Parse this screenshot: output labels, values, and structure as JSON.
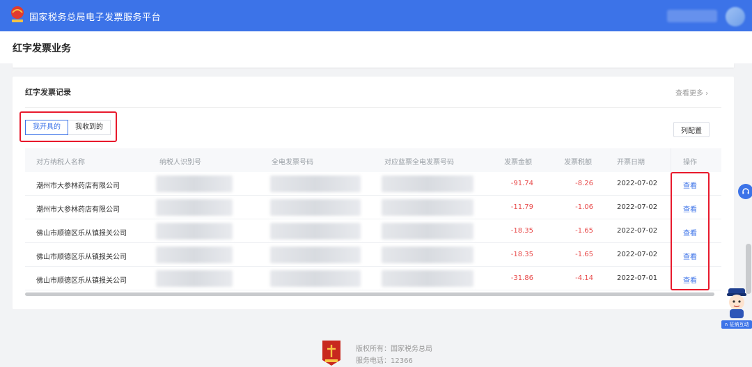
{
  "header": {
    "site_title": "国家税务总局电子发票服务平台"
  },
  "page": {
    "title": "红字发票业务"
  },
  "records": {
    "title": "红字发票记录",
    "more_label": "查看更多 ›",
    "tabs": [
      {
        "label": "我开具的",
        "active": true
      },
      {
        "label": "我收到的",
        "active": false
      }
    ],
    "column_config_label": "列配置",
    "columns": [
      "对方纳税人名称",
      "纳税人识别号",
      "全电发票号码",
      "对应蓝票全电发票号码",
      "发票金额",
      "发票税额",
      "开票日期",
      "操作"
    ],
    "rows": [
      {
        "name": "潮州市大参林药店有限公司",
        "amount": "-91.74",
        "tax": "-8.26",
        "date": "2022-07-02",
        "action": "查看"
      },
      {
        "name": "潮州市大参林药店有限公司",
        "amount": "-11.79",
        "tax": "-1.06",
        "date": "2022-07-02",
        "action": "查看"
      },
      {
        "name": "佛山市顺德区乐从镇报关公司",
        "amount": "-18.35",
        "tax": "-1.65",
        "date": "2022-07-02",
        "action": "查看"
      },
      {
        "name": "佛山市顺德区乐从镇报关公司",
        "amount": "-18.35",
        "tax": "-1.65",
        "date": "2022-07-02",
        "action": "查看"
      },
      {
        "name": "佛山市顺德区乐从镇报关公司",
        "amount": "-31.86",
        "tax": "-4.14",
        "date": "2022-07-01",
        "action": "查看"
      }
    ]
  },
  "side": {
    "service_icon": "headset-icon",
    "mascot_label": "∩ 征纳互动"
  },
  "footer": {
    "copyright": "版权所有：国家税务总局",
    "phone": "服务电话：12366"
  },
  "colors": {
    "brand": "#3c73e8",
    "negative": "#e84d4d",
    "highlight": "#e8192c"
  }
}
